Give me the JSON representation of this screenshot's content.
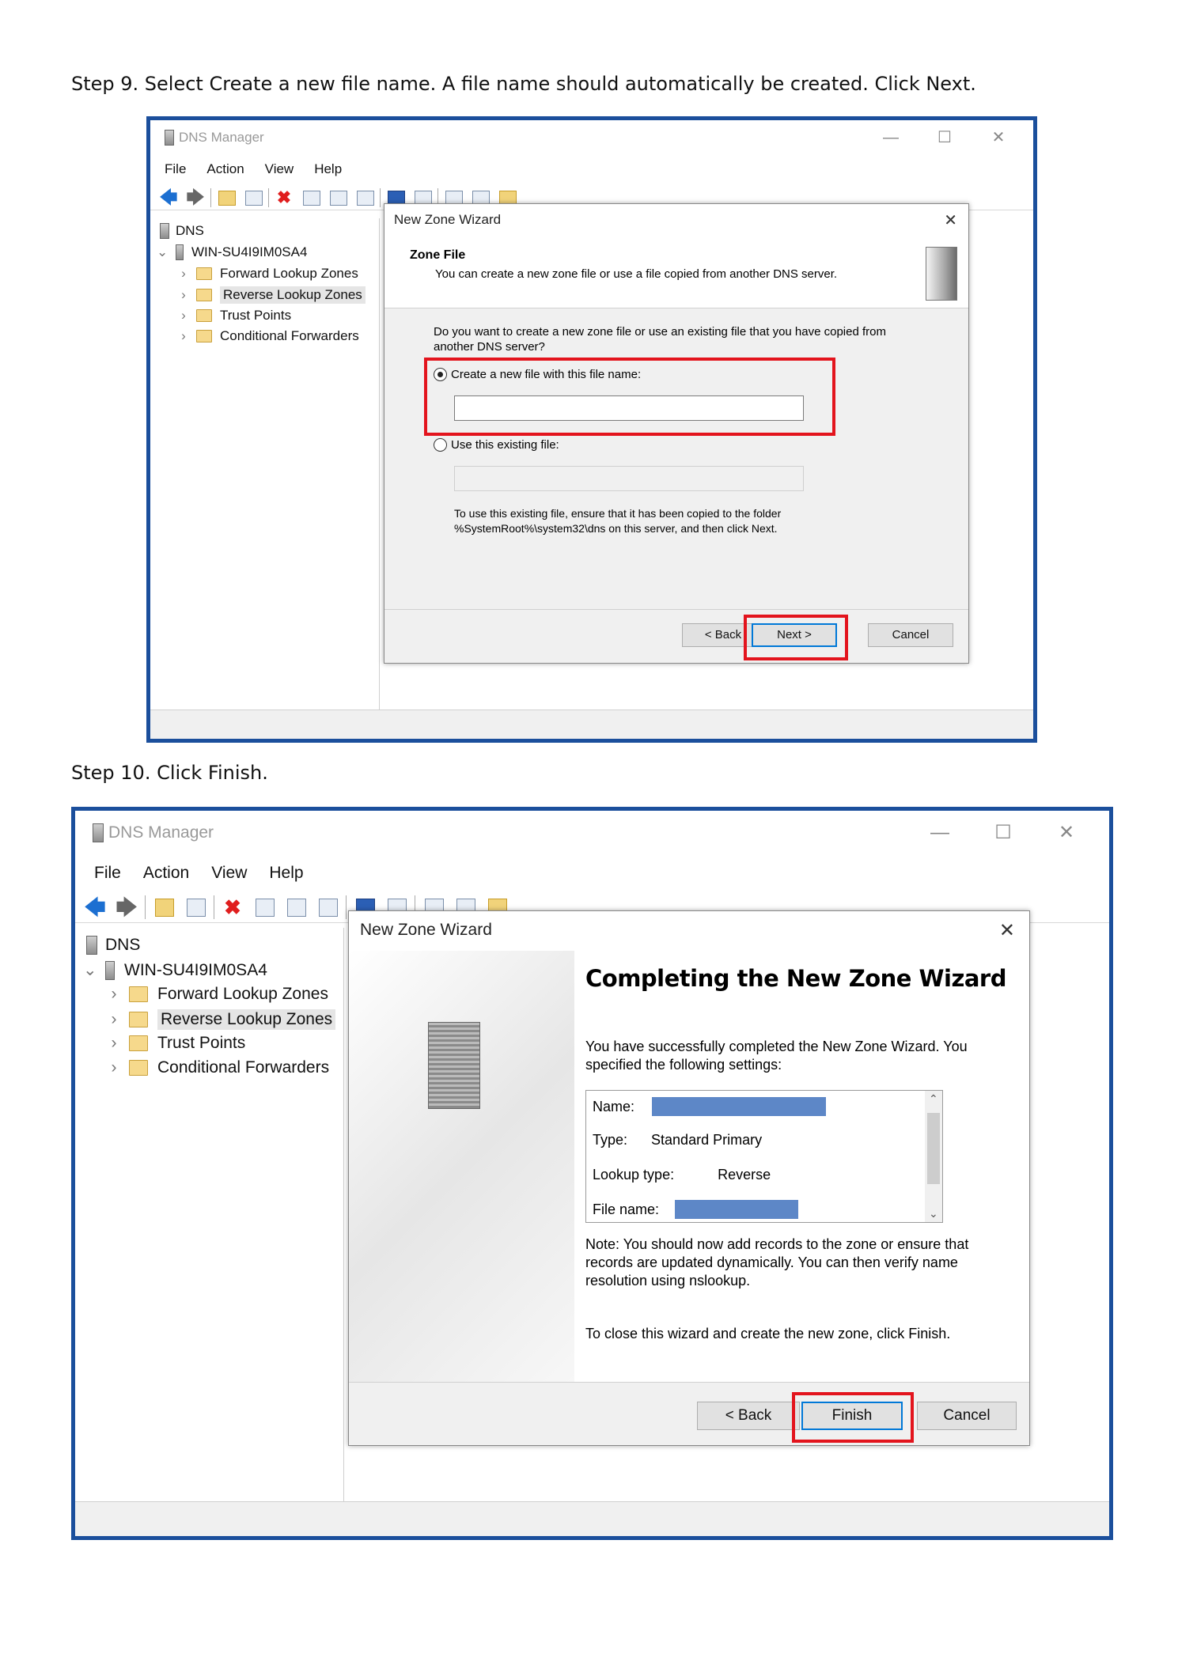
{
  "step9": {
    "text": "Step 9. Select Create a new file name. A file name should automatically be created. Click Next.",
    "window": {
      "title": "DNS Manager",
      "minimize": "—",
      "maximize": "☐",
      "close": "✕",
      "menu": [
        "File",
        "Action",
        "View",
        "Help"
      ],
      "tree": {
        "root": "DNS",
        "server": "WIN-SU4I9IM0SA4",
        "items": [
          "Forward Lookup Zones",
          "Reverse Lookup Zones",
          "Trust Points",
          "Conditional Forwarders"
        ]
      }
    },
    "dialog": {
      "title": "New Zone Wizard",
      "close": "✕",
      "header_title": "Zone File",
      "header_desc": "You can create a new zone file or use a file copied from another DNS server.",
      "question": "Do you want to create a new zone file or use an existing file that you have copied from another DNS server?",
      "option_new": "Create a new file with this file name:",
      "option_existing": "Use this existing file:",
      "note_line1": "To use this existing file, ensure that it has been copied to the folder",
      "note_line2": "%SystemRoot%\\system32\\dns on this server, and then click Next.",
      "back": "< Back",
      "next": "Next >",
      "cancel": "Cancel"
    }
  },
  "step10": {
    "text": "Step 10. Click Finish.",
    "window": {
      "title": "DNS Manager",
      "minimize": "—",
      "maximize": "☐",
      "close": "✕",
      "menu": [
        "File",
        "Action",
        "View",
        "Help"
      ],
      "tree": {
        "root": "DNS",
        "server": "WIN-SU4I9IM0SA4",
        "items": [
          "Forward Lookup Zones",
          "Reverse Lookup Zones",
          "Trust Points",
          "Conditional Forwarders"
        ]
      }
    },
    "dialog": {
      "title": "New Zone Wizard",
      "close": "✕",
      "heading": "Completing the New Zone Wizard",
      "intro": "You have successfully completed the New Zone Wizard. You specified the following settings:",
      "settings": {
        "name_label": "Name:",
        "type_label": "Type:",
        "type_value": "Standard Primary",
        "lookup_label": "Lookup type:",
        "lookup_value": "Reverse",
        "file_label": "File name:"
      },
      "note": "Note: You should now add records to the zone or ensure that records are updated dynamically. You can then verify name resolution using nslookup.",
      "close_hint": "To close this wizard and create the new zone, click Finish.",
      "back": "< Back",
      "finish": "Finish",
      "cancel": "Cancel"
    }
  },
  "colors": {
    "frame": "#1b4f9c",
    "highlight": "#e3141d",
    "redaction": "#5d87c7",
    "primary_button": "#0078d7"
  }
}
